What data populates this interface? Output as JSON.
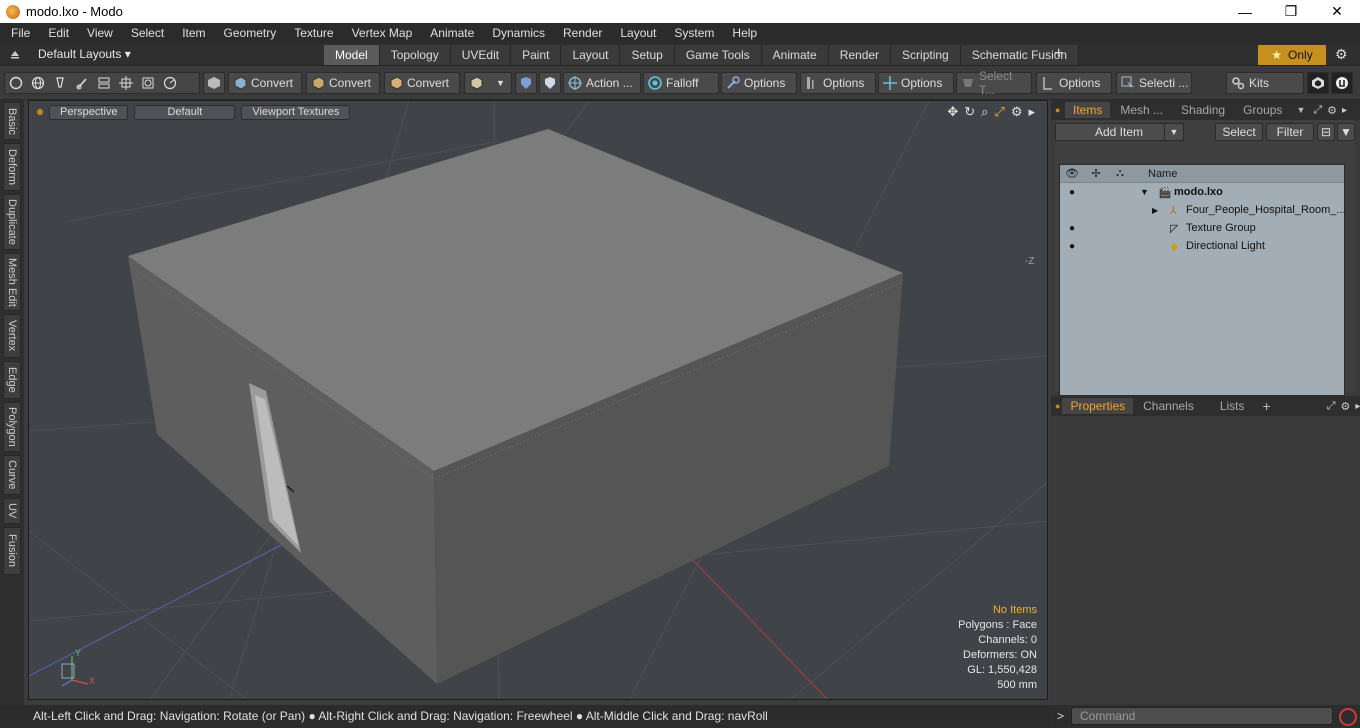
{
  "window": {
    "title": "modo.lxo - Modo",
    "minimize": "—",
    "maximize": "❐",
    "close": "✕"
  },
  "menu": [
    "File",
    "Edit",
    "View",
    "Select",
    "Item",
    "Geometry",
    "Texture",
    "Vertex Map",
    "Animate",
    "Dynamics",
    "Render",
    "Layout",
    "System",
    "Help"
  ],
  "layouts": {
    "label": "Default Layouts ▾"
  },
  "tabs": [
    {
      "label": "Model",
      "active": true
    },
    {
      "label": "Topology"
    },
    {
      "label": "UVEdit"
    },
    {
      "label": "Paint"
    },
    {
      "label": "Layout"
    },
    {
      "label": "Setup"
    },
    {
      "label": "Game Tools"
    },
    {
      "label": "Animate"
    },
    {
      "label": "Render"
    },
    {
      "label": "Scripting"
    },
    {
      "label": "Schematic Fusion"
    }
  ],
  "only_label": "Only",
  "toolbar": {
    "convert1": "Convert",
    "convert2": "Convert",
    "convert3": "Convert",
    "action": "Action ...",
    "falloff": "Falloff",
    "options1": "Options",
    "options2": "Options",
    "options3": "Options",
    "select_t": "Select T...",
    "options4": "Options",
    "selecti": "Selecti ...",
    "kits": "Kits"
  },
  "left_tabs": [
    "Basic",
    "Deform",
    "Duplicate",
    "Mesh Edit",
    "Vertex",
    "Edge",
    "Polygon",
    "Curve",
    "UV",
    "Fusion"
  ],
  "viewport": {
    "perspective": "Perspective",
    "default": "Default",
    "textures": "Viewport Textures",
    "axis_label": "-Z",
    "stats": {
      "no_items": "No Items",
      "polygons": "Polygons : Face",
      "channels": "Channels: 0",
      "deformers": "Deformers: ON",
      "gl": "GL: 1,550,428",
      "scale": "500 mm"
    },
    "gizmo": {
      "y": "Y",
      "x": "X"
    }
  },
  "items_panel": {
    "tabs": [
      "Items",
      "Mesh ...",
      "Shading",
      "Groups"
    ],
    "add_item": "Add Item",
    "select": "Select",
    "filter": "Filter",
    "col_name": "Name",
    "rows": [
      {
        "name": "modo.lxo",
        "bold": true
      },
      {
        "name": "Four_People_Hospital_Room_..."
      },
      {
        "name": "Texture Group"
      },
      {
        "name": "Directional Light"
      }
    ]
  },
  "props_panel": {
    "tabs": [
      "Properties",
      "Channels",
      "Lists"
    ]
  },
  "status": "Alt-Left Click and Drag: Navigation: Rotate (or Pan) ● Alt-Right Click and Drag: Navigation: Freewheel ● Alt-Middle Click and Drag: navRoll",
  "command": {
    "prompt": ">",
    "placeholder": "Command"
  }
}
